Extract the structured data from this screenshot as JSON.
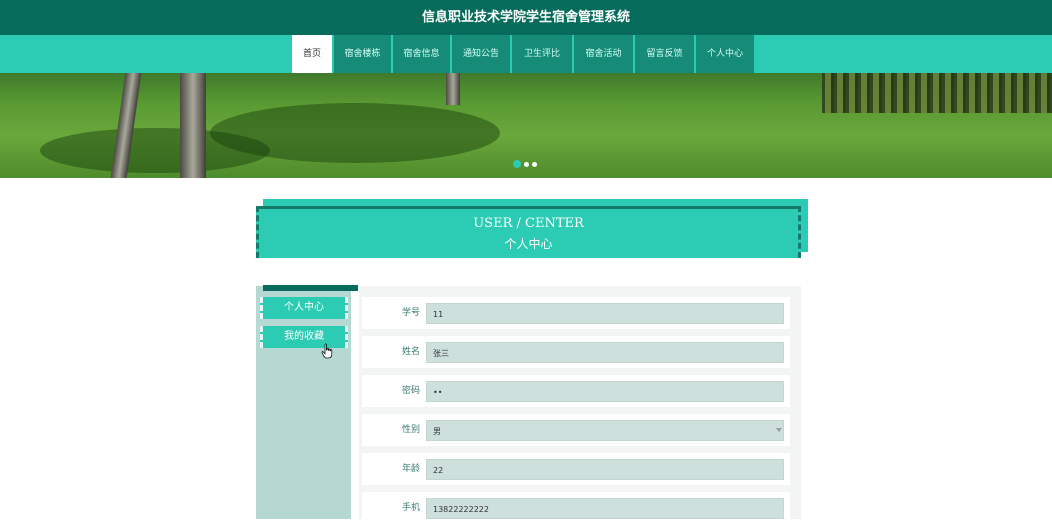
{
  "header": {
    "title": "信息职业技术学院学生宿舍管理系统"
  },
  "nav": {
    "items": [
      {
        "label": "首页",
        "active": true
      },
      {
        "label": "宿舍楼栋",
        "active": false
      },
      {
        "label": "宿舍信息",
        "active": false
      },
      {
        "label": "通知公告",
        "active": false
      },
      {
        "label": "卫生评比",
        "active": false
      },
      {
        "label": "宿舍活动",
        "active": false
      },
      {
        "label": "留言反馈",
        "active": false
      },
      {
        "label": "个人中心",
        "active": false
      }
    ]
  },
  "banner": {
    "slide_count": 3,
    "active_slide": 1
  },
  "section": {
    "title_en": "USER / CENTER",
    "title_cn": "个人中心"
  },
  "sidebar": {
    "items": [
      {
        "label": "个人中心"
      },
      {
        "label": "我的收藏"
      }
    ]
  },
  "form": {
    "fields": [
      {
        "label": "学号",
        "value": "11",
        "type": "text"
      },
      {
        "label": "姓名",
        "value": "张三",
        "type": "text"
      },
      {
        "label": "密码",
        "value": "••",
        "type": "password"
      },
      {
        "label": "性别",
        "value": "男",
        "type": "select"
      },
      {
        "label": "年龄",
        "value": "22",
        "type": "text"
      },
      {
        "label": "手机",
        "value": "13822222222",
        "type": "text"
      }
    ]
  },
  "colors": {
    "primary": "#2ccbb3",
    "dark": "#066b5b",
    "nav_item": "#168c78",
    "sidebar": "#b6d8d3",
    "field": "#cde0dc"
  },
  "icons": [
    "hand-pointer-icon"
  ]
}
